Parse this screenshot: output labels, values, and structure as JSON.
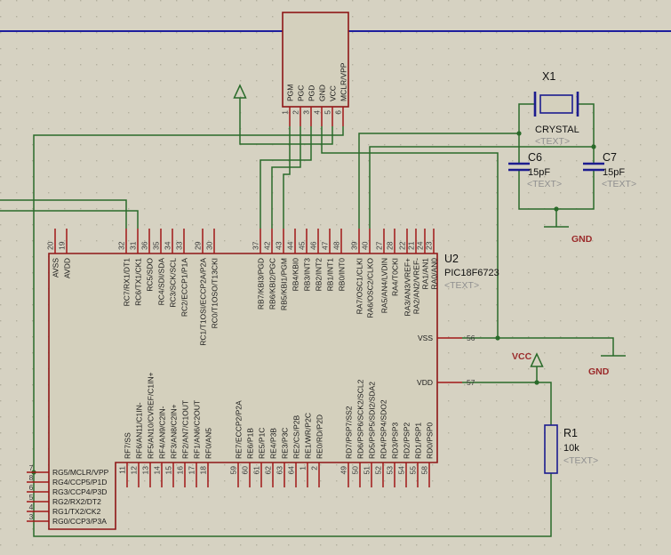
{
  "programmer": {
    "pins": [
      {
        "num": "1",
        "label": "PGM"
      },
      {
        "num": "2",
        "label": "PGC"
      },
      {
        "num": "3",
        "label": "PGD"
      },
      {
        "num": "4",
        "label": "GND"
      },
      {
        "num": "5",
        "label": "VCC"
      },
      {
        "num": "6",
        "label": "MCLR/VPP"
      }
    ]
  },
  "ic": {
    "ref": "U2",
    "part": "PIC18F6723",
    "text": "<TEXT>",
    "top": [
      {
        "num": "20",
        "name": "AVSS"
      },
      {
        "num": "19",
        "name": "AVDD"
      },
      {
        "num": "32",
        "name": "RC7/RX1/DT1"
      },
      {
        "num": "31",
        "name": "RC6/TX1/CK1"
      },
      {
        "num": "36",
        "name": "RC5/SDO"
      },
      {
        "num": "35",
        "name": "RC4/SDI/SDA"
      },
      {
        "num": "34",
        "name": "RC3/SCK/SCL"
      },
      {
        "num": "33",
        "name": "RC2/ECCP1/P1A"
      },
      {
        "num": "29",
        "name": "RC1/T1OSI/ECCP2A/P2A"
      },
      {
        "num": "30",
        "name": "RC0/T1OSO/T13CKI"
      },
      {
        "num": "37",
        "name": "RB7/KBI3/PGD"
      },
      {
        "num": "42",
        "name": "RB6/KBI2/PGC"
      },
      {
        "num": "43",
        "name": "RB5/KBI1/PGM"
      },
      {
        "num": "44",
        "name": "RB4/KBI0"
      },
      {
        "num": "45",
        "name": "RB3/INT3"
      },
      {
        "num": "46",
        "name": "RB2/INT2"
      },
      {
        "num": "47",
        "name": "RB1/INT1"
      },
      {
        "num": "48",
        "name": "RB0/INT0"
      },
      {
        "num": "39",
        "name": "RA7/OSC1/CLKI"
      },
      {
        "num": "40",
        "name": "RA6/OSC2/CLKO"
      },
      {
        "num": "27",
        "name": "RA5/AN4/LVDIN"
      },
      {
        "num": "28",
        "name": "RA4/T0CKI"
      },
      {
        "num": "22",
        "name": "RA3/AN3/VREF+"
      },
      {
        "num": "21",
        "name": "RA2/AN2/VREF-"
      },
      {
        "num": "24",
        "name": "RA1/AN1"
      },
      {
        "num": "23",
        "name": "RA0/AN0"
      }
    ],
    "bottom": [
      {
        "num": "11",
        "name": "RF7/SS"
      },
      {
        "num": "12",
        "name": "RF6/AN11/C1IN-"
      },
      {
        "num": "13",
        "name": "RF5/AN10/CVREF/C1IN+"
      },
      {
        "num": "14",
        "name": "RF4/AN9/C2IN-"
      },
      {
        "num": "15",
        "name": "RF3/AN8/C2IN+"
      },
      {
        "num": "16",
        "name": "RF2/AN7/C1OUT"
      },
      {
        "num": "17",
        "name": "RF1/AN6/C2OUT"
      },
      {
        "num": "18",
        "name": "RF0/AN5"
      },
      {
        "num": "59",
        "name": "RE7/ECCP2/P2A"
      },
      {
        "num": "60",
        "name": "RE6/P1B"
      },
      {
        "num": "61",
        "name": "RE5/P1C"
      },
      {
        "num": "62",
        "name": "RE4/P3B"
      },
      {
        "num": "63",
        "name": "RE3/P3C"
      },
      {
        "num": "64",
        "name": "RE2/CS/P2B"
      },
      {
        "num": "1",
        "name": "RE1/WR/P2C"
      },
      {
        "num": "2",
        "name": "RE0/RD/P2D"
      },
      {
        "num": "49",
        "name": "RD7/PSP7/SS2"
      },
      {
        "num": "50",
        "name": "RD6/PSP6/SCK2/SCL2"
      },
      {
        "num": "51",
        "name": "RD5/PSP5/SDI2/SDA2"
      },
      {
        "num": "52",
        "name": "RD4/PSP4/SDO2"
      },
      {
        "num": "53",
        "name": "RD3/PSP3"
      },
      {
        "num": "54",
        "name": "RD2/PSP2"
      },
      {
        "num": "55",
        "name": "RD1/PSP1"
      },
      {
        "num": "58",
        "name": "RD0/PSP0"
      }
    ],
    "left": [
      {
        "num": "7",
        "name": "RG5/MCLR/VPP"
      },
      {
        "num": "8",
        "name": "RG4/CCP5/P1D"
      },
      {
        "num": "6",
        "name": "RG3/CCP4/P3D"
      },
      {
        "num": "5",
        "name": "RG2/RX2/DT2"
      },
      {
        "num": "4",
        "name": "RG1/TX2/CK2"
      },
      {
        "num": "3",
        "name": "RG0/CCP3/P3A"
      }
    ],
    "right": [
      {
        "num": "56",
        "name": "VSS"
      },
      {
        "num": "57",
        "name": "VDD"
      }
    ]
  },
  "crystal": {
    "ref": "X1",
    "value": "CRYSTAL",
    "text": "<TEXT>"
  },
  "c6": {
    "ref": "C6",
    "value": "15pF",
    "text": "<TEXT>"
  },
  "c7": {
    "ref": "C7",
    "value": "15pF",
    "text": "<TEXT>"
  },
  "r1": {
    "ref": "R1",
    "value": "10k",
    "text": "<TEXT>"
  },
  "nets": {
    "vcc": "VCC",
    "gnd1": "GND",
    "gnd2": "GND"
  },
  "colors": {
    "background": "#d6d2c2",
    "wire": "#2a6b2a",
    "pin": "#a01818",
    "component_outline": "#8e1616",
    "passive_outline": "#1c1c8f",
    "net_label": "#9b2b2b",
    "sheet_line": "#1e1e9e"
  }
}
